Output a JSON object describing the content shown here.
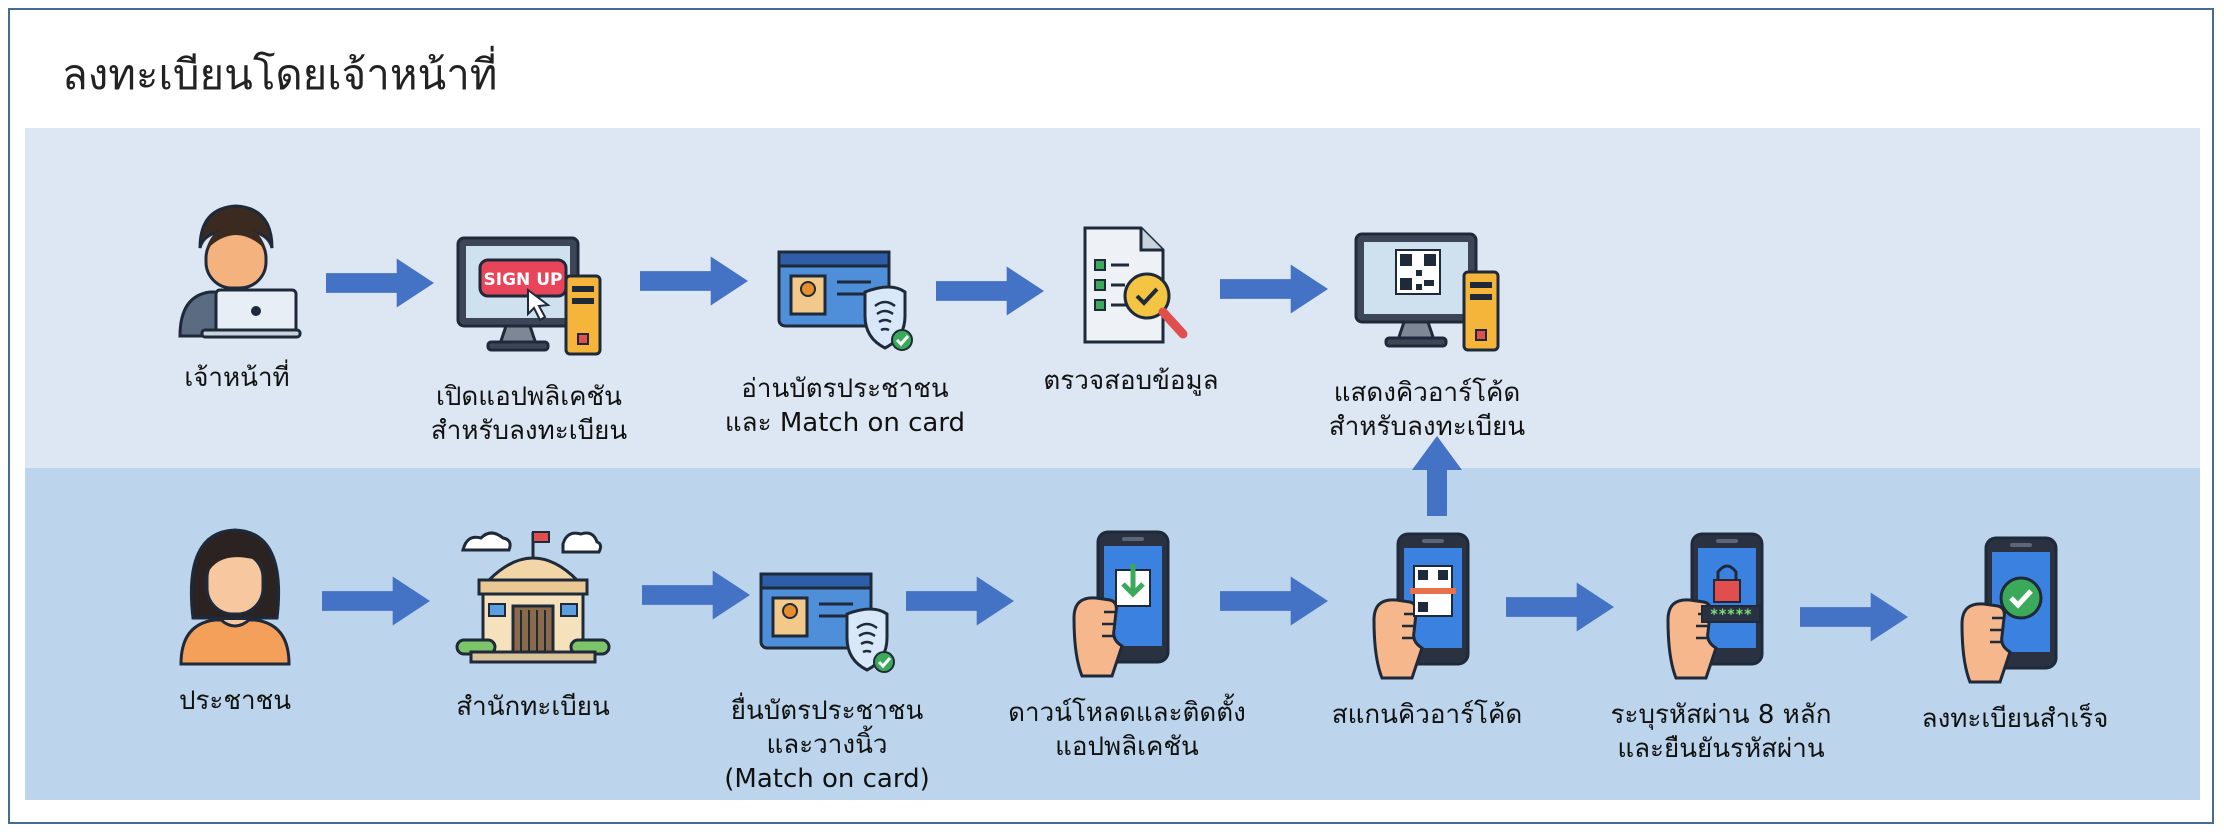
{
  "title": "ลงทะเบียนโดยเจ้าหน้าที่",
  "colors": {
    "arrow": "#4472c4",
    "band_top": "#dde7f3",
    "band_bottom": "#bcd5ec",
    "frame": "#4a6a96"
  },
  "top_row": [
    {
      "icon": "officer-laptop-icon",
      "label": "เจ้าหน้าที่"
    },
    {
      "icon": "signup-computer-icon",
      "label": "เปิดแอปพลิเคชัน\nสำหรับลงทะเบียน",
      "screen_text": "SIGN UP"
    },
    {
      "icon": "id-card-fingerprint-icon",
      "label": "อ่านบัตรประชาชน\nและ Match on card"
    },
    {
      "icon": "document-check-icon",
      "label": "ตรวจสอบข้อมูล"
    },
    {
      "icon": "qr-computer-icon",
      "label": "แสดงคิวอาร์โค้ด\nสำหรับลงทะเบียน"
    }
  ],
  "bottom_row": [
    {
      "icon": "citizen-woman-icon",
      "label": "ประชาชน"
    },
    {
      "icon": "registration-office-icon",
      "label": "สำนักทะเบียน"
    },
    {
      "icon": "id-card-fingerprint-icon",
      "label": "ยื่นบัตรประชาชน\nและวางนิ้ว\n(Match on card)"
    },
    {
      "icon": "phone-download-icon",
      "label": "ดาวน์โหลดและติดตั้ง\nแอปพลิเคชัน"
    },
    {
      "icon": "phone-qr-scan-icon",
      "label": "สแกนคิวอาร์โค้ด"
    },
    {
      "icon": "phone-password-icon",
      "label": "ระบุรหัสผ่าน 8 หลัก\nและยืนยันรหัสผ่าน",
      "screen_text": "*****"
    },
    {
      "icon": "phone-success-icon",
      "label": "ลงทะเบียนสำเร็จ"
    }
  ]
}
